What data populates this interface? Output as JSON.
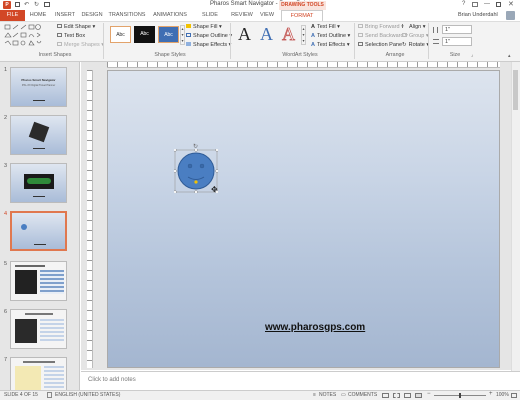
{
  "window": {
    "title": "Pharos Smart Navigator - PowerPoint",
    "contextual_group": "DRAWING TOOLS",
    "user": "Brian Underdahl"
  },
  "tabs": [
    "FILE",
    "HOME",
    "INSERT",
    "DESIGN",
    "TRANSITIONS",
    "ANIMATIONS",
    "SLIDE SHOW",
    "REVIEW",
    "VIEW",
    "FORMAT"
  ],
  "ribbon": {
    "insert_shapes": {
      "edit_shape": "Edit Shape",
      "text_box": "Text Box",
      "merge_shapes": "Merge Shapes",
      "group_label": "Insert Shapes"
    },
    "shape_styles": {
      "swatches": [
        "Abc",
        "Abc",
        "Abc"
      ],
      "shape_fill": "Shape Fill",
      "shape_outline": "Shape Outline",
      "shape_effects": "Shape Effects",
      "group_label": "Shape Styles"
    },
    "wordart": {
      "letters": [
        "A",
        "A",
        "A"
      ],
      "text_fill": "Text Fill",
      "text_outline": "Text Outline",
      "text_effects": "Text Effects",
      "group_label": "WordArt Styles"
    },
    "arrange": {
      "bring_forward": "Bring Forward",
      "send_backward": "Send Backward",
      "selection_pane": "Selection Pane",
      "align": "Align",
      "group": "Group",
      "rotate": "Rotate",
      "group_label": "Arrange"
    },
    "size": {
      "height": "1\"",
      "width": "1\"",
      "group_label": "Size"
    }
  },
  "slides": {
    "numbers": [
      "1",
      "2",
      "3",
      "4",
      "5",
      "6",
      "7"
    ],
    "thumb1_title": "Pharos Smart Navigator",
    "thumb1_subtitle": "PXL-XX Digital Travel Planner"
  },
  "slide": {
    "url_text": "www.pharosgps.com"
  },
  "notes_placeholder": "Click to add notes",
  "status": {
    "slide_counter": "SLIDE 4 OF 15",
    "language": "ENGLISH (UNITED STATES)",
    "notes": "NOTES",
    "comments": "COMMENTS",
    "zoom": "100%"
  },
  "colors": {
    "accent": "#D24726",
    "format_tab": "#D24726",
    "smiley_fill": "#4a7ec2",
    "ribbon_bg": "#f3f3f3"
  }
}
